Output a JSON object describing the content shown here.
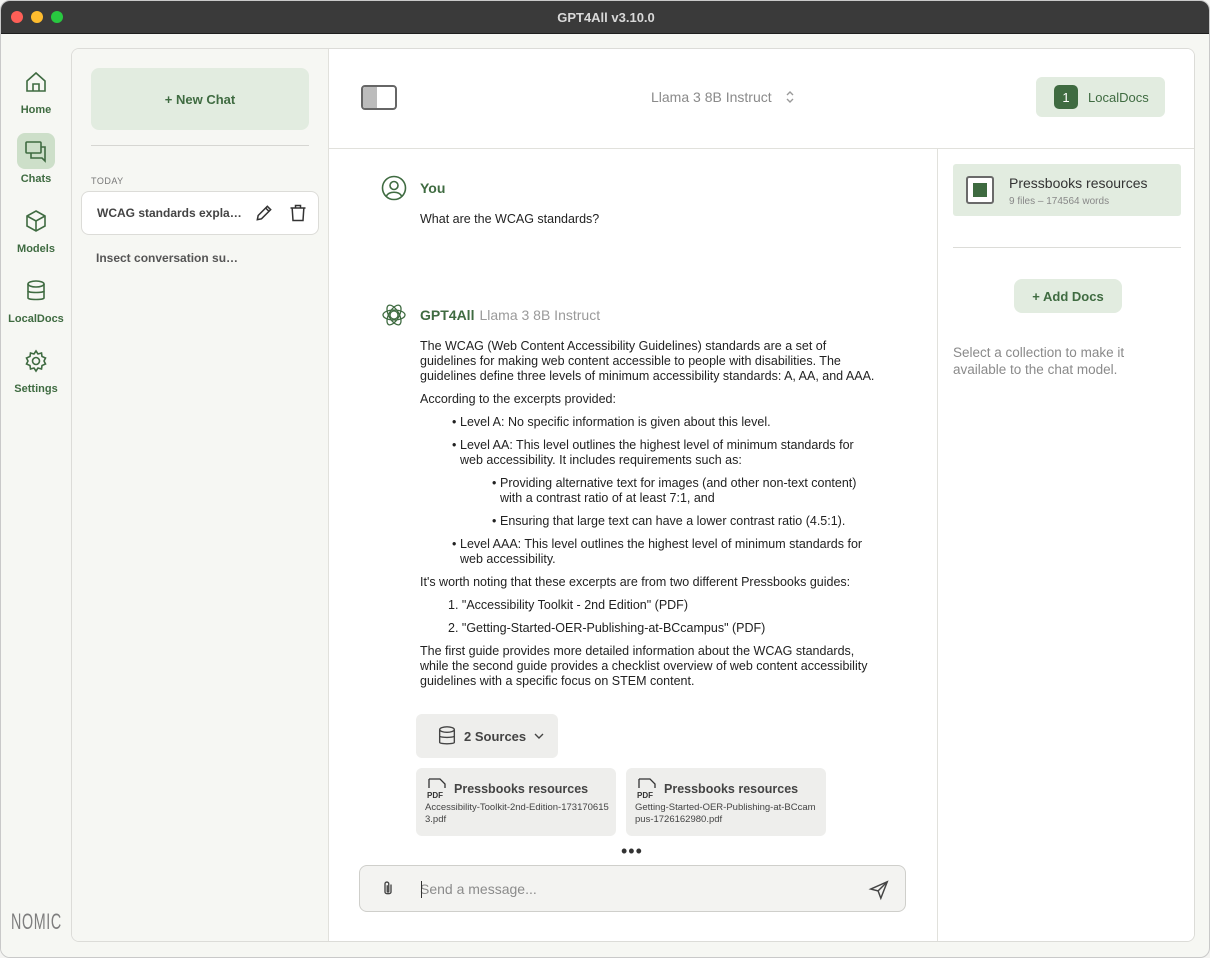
{
  "window": {
    "title": "GPT4All v3.10.0"
  },
  "nav": {
    "items": [
      {
        "label": "Home",
        "icon": "home-icon"
      },
      {
        "label": "Chats",
        "icon": "chat-icon"
      },
      {
        "label": "Models",
        "icon": "cube-icon"
      },
      {
        "label": "LocalDocs",
        "icon": "database-icon"
      },
      {
        "label": "Settings",
        "icon": "gear-icon"
      }
    ],
    "active": "Chats",
    "brand": "NOMIC"
  },
  "sidebar": {
    "new_chat": "+ New Chat",
    "section_label": "TODAY",
    "chats": [
      {
        "title": "WCAG standards explanation",
        "active": true
      },
      {
        "title": "Insect conversation summary",
        "active": false
      }
    ]
  },
  "topbar": {
    "model_name": "Llama 3 8B Instruct",
    "localdocs_count": "1",
    "localdocs_label": "LocalDocs"
  },
  "conversation": {
    "user": {
      "name": "You",
      "message": "What are the WCAG standards?"
    },
    "assistant": {
      "name": "GPT4All",
      "model": "Llama 3 8B Instruct",
      "intro": "The WCAG (Web Content Accessibility Guidelines) standards are a set of guidelines for making web content accessible to people with disabilities. The guidelines define three levels of minimum accessibility standards: A, AA, and AAA.",
      "according": "According to the excerpts provided:",
      "level_a": "Level A: No specific information is given about this level.",
      "level_aa": "Level AA: This level outlines the highest level of minimum standards for web accessibility. It includes requirements such as:",
      "aa_sub1": "Providing alternative text for images (and other non-text content) with a contrast ratio of at least 7:1, and",
      "aa_sub2": "Ensuring that large text can have a lower contrast ratio (4.5:1).",
      "level_aaa": "Level AAA: This level outlines the highest level of minimum standards for web accessibility.",
      "noting": "It's worth noting that these excerpts are from two different Pressbooks guides:",
      "guide1": "1. \"Accessibility Toolkit - 2nd Edition\" (PDF)",
      "guide2": "2. \"Getting-Started-OER-Publishing-at-BCcampus\" (PDF)",
      "closing": "The first guide provides more detailed information about the WCAG standards, while the second guide provides a checklist overview of web content accessibility guidelines with a specific focus on STEM content."
    },
    "sources_button": "2 Sources",
    "sources": [
      {
        "collection": "Pressbooks resources",
        "file": "Accessibility-Toolkit-2nd-Edition-1731706153.pdf"
      },
      {
        "collection": "Pressbooks resources",
        "file": "Getting-Started-OER-Publishing-at-BCcampus-1726162980.pdf"
      }
    ],
    "more_indicator": "•••",
    "input_placeholder": "Send a message..."
  },
  "localdocs_panel": {
    "collection_name": "Pressbooks resources",
    "collection_meta": "9 files – 174564 words",
    "collection_checked": true,
    "add_docs": "+ Add Docs",
    "hint": "Select a collection to make it available to the chat model."
  },
  "colors": {
    "accent": "#3f6b41",
    "accent_light": "#e2ece0",
    "titlebar": "#3a3a3a"
  }
}
